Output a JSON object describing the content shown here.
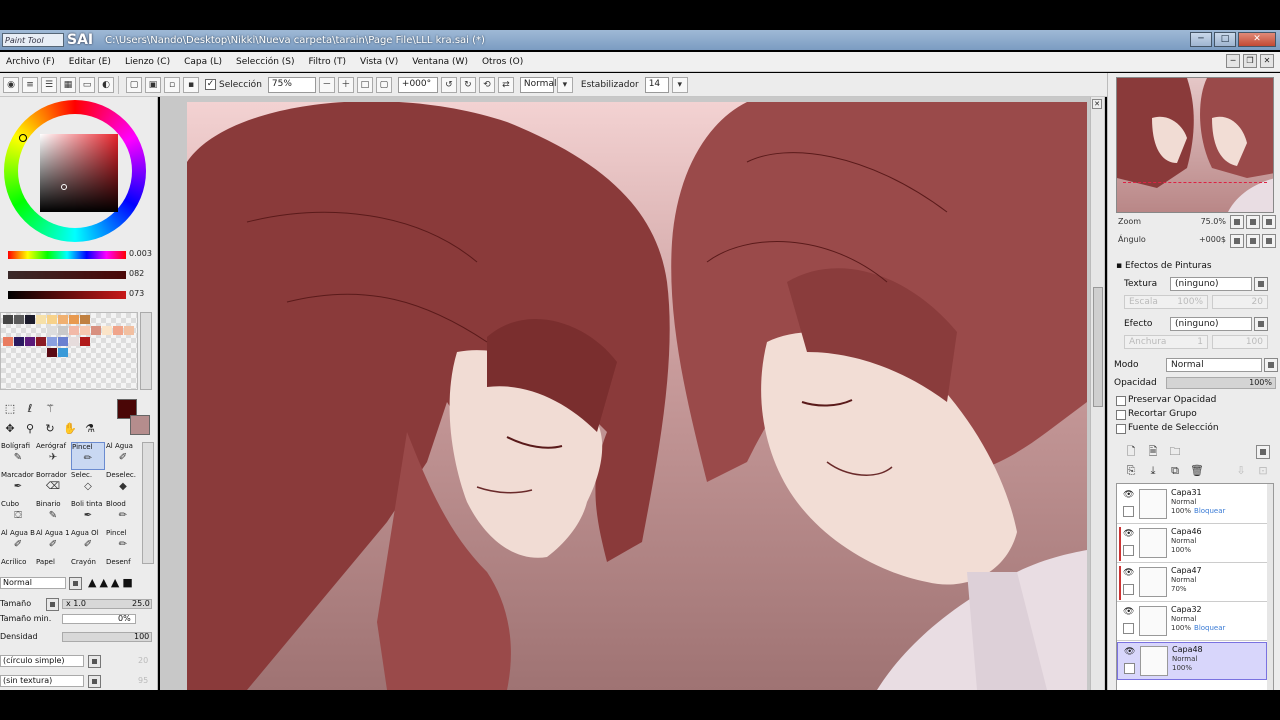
{
  "window": {
    "app_badge": "Paint Tool",
    "app_name": "SAI",
    "title": "C:\\Users\\Nando\\Desktop\\Nikki\\Nueva carpeta\\tarain\\Page File\\LLL kra.sai (*)",
    "buttons": {
      "minimize": "─",
      "maximize": "□",
      "close": "✕"
    }
  },
  "menu": [
    "Archivo (F)",
    "Editar (E)",
    "Lienzo (C)",
    "Capa (L)",
    "Selección (S)",
    "Filtro (T)",
    "Vista (V)",
    "Ventana (W)",
    "Otros (O)"
  ],
  "toolbar": {
    "selection_label": "Selección",
    "zoom": "75%",
    "angle": "+000°",
    "blend_mode": "Normal",
    "stabilizer_label": "Estabilizador",
    "stabilizer_value": "14"
  },
  "colors": {
    "hue_value": "0.003",
    "sat_value": "082",
    "val_value": "073",
    "primary": "#4a0606",
    "secondary": "#b58d8d"
  },
  "swatch_colors": [
    "#444444",
    "#5a5a5a",
    "#1c1c2c",
    "#f6e0a8",
    "#f7d28a",
    "#f0b070",
    "#e89a50",
    "#c08040",
    "#dddddd",
    "#c9c9c9",
    "#f2b9a8",
    "#f7c8b0",
    "#d89080",
    "#fbe4c8",
    "#f0a48a",
    "#f2bfa0",
    "#e97c60",
    "#2a1a60",
    "#5a1a7a",
    "#8c1a24",
    "#8aa0e0",
    "#6a80d0",
    "#e6dcdc",
    "#b11b1b",
    "#5a0a14",
    "#3a9ad8"
  ],
  "brushes": [
    {
      "label": "Bolígrafi",
      "icon": "✎"
    },
    {
      "label": "Aerógraf",
      "icon": "✈"
    },
    {
      "label": "Pincel",
      "icon": "✏"
    },
    {
      "label": "Al Agua",
      "icon": "✐"
    },
    {
      "label": "Marcador",
      "icon": "✒"
    },
    {
      "label": "Borrador",
      "icon": "⌫"
    },
    {
      "label": "Selec.",
      "icon": "◇"
    },
    {
      "label": "Deselec.",
      "icon": "◆"
    },
    {
      "label": "Cubo",
      "icon": "⛋"
    },
    {
      "label": "Binario",
      "icon": "✎"
    },
    {
      "label": "Boli tinta",
      "icon": "✒"
    },
    {
      "label": "Blood",
      "icon": "✏"
    },
    {
      "label": "Al Agua B",
      "icon": "✐"
    },
    {
      "label": "Al Agua 10",
      "icon": "✐"
    },
    {
      "label": "Agua Ol",
      "icon": "✐"
    },
    {
      "label": "Pincel",
      "icon": "✏"
    },
    {
      "label": "Acrílico",
      "icon": ""
    },
    {
      "label": "Papel",
      "icon": ""
    },
    {
      "label": "Crayón",
      "icon": ""
    },
    {
      "label": "Desenf",
      "icon": ""
    }
  ],
  "brush_props": {
    "mode": "Normal",
    "size_label": "Tamaño",
    "size_mult": "x 1.0",
    "size_value": "25.0",
    "min_size_label": "Tamaño min.",
    "min_size_value": "0%",
    "density_label": "Densidad",
    "density_value": "100",
    "shape": "(círculo simple)",
    "shape_value": "20",
    "texture": "(sin textura)",
    "texture_value": "95"
  },
  "navigator": {
    "zoom_label": "Zoom",
    "zoom_value": "75.0%",
    "angle_label": "Ángulo",
    "angle_value": "+000$"
  },
  "paint_effects": {
    "heading": "Efectos de Pinturas",
    "texture_label": "Textura",
    "texture_value": "(ninguno)",
    "scale_label": "Escala",
    "scale_value": "100%",
    "scale_num": "20",
    "effect_label": "Efecto",
    "effect_value": "(ninguno)",
    "width_label": "Anchura",
    "width_value": "1",
    "width_num": "100"
  },
  "layer_props": {
    "mode_label": "Modo",
    "mode_value": "Normal",
    "opacity_label": "Opacidad",
    "opacity_value": "100%",
    "opts": [
      "Preservar Opacidad",
      "Recortar Grupo",
      "Fuente de Selección"
    ]
  },
  "layers": [
    {
      "name": "Capa31",
      "mode": "Normal",
      "opacity": "100%",
      "lock": "Bloquear",
      "selected": false,
      "clip": false
    },
    {
      "name": "Capa46",
      "mode": "Normal",
      "opacity": "100%",
      "lock": "",
      "selected": false,
      "clip": true
    },
    {
      "name": "Capa47",
      "mode": "Normal",
      "opacity": "70%",
      "lock": "",
      "selected": false,
      "clip": true
    },
    {
      "name": "Capa32",
      "mode": "Normal",
      "opacity": "100%",
      "lock": "Bloquear",
      "selected": false,
      "clip": false
    },
    {
      "name": "Capa48",
      "mode": "Normal",
      "opacity": "100%",
      "lock": "",
      "selected": true,
      "clip": false
    }
  ]
}
